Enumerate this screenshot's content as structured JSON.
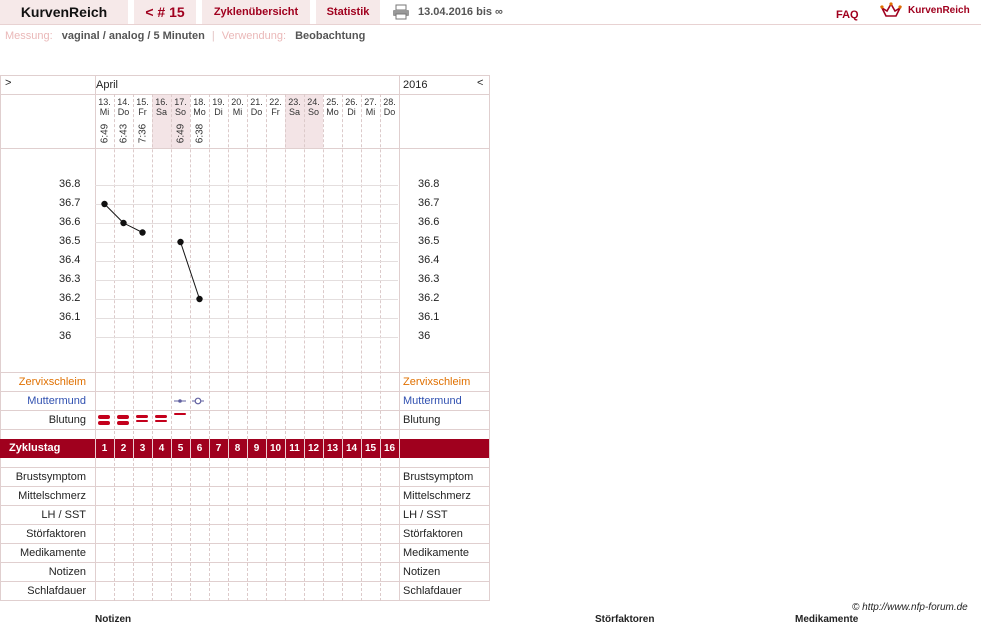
{
  "topbar": {
    "brand": "KurvenReich",
    "cycle": "< # 15",
    "overview": "Zyklenübersicht",
    "stats": "Statistik",
    "date_range": "13.04.2016 bis ∞",
    "faq": "FAQ",
    "logo_text": "KurvenReich"
  },
  "info": {
    "measure_label": "Messung:",
    "measure_value": "vaginal / analog / 5 Minuten",
    "use_label": "Verwendung:",
    "use_value": "Beobachtung"
  },
  "chart_header": {
    "nav_prev": ">",
    "nav_next": "<",
    "month": "April",
    "year": "2016"
  },
  "days": [
    {
      "date": "13.",
      "wd": "Mi",
      "time": "6:49",
      "weekend": false
    },
    {
      "date": "14.",
      "wd": "Do",
      "time": "6:43",
      "weekend": false
    },
    {
      "date": "15.",
      "wd": "Fr",
      "time": "7:36",
      "weekend": false
    },
    {
      "date": "16.",
      "wd": "Sa",
      "time": "",
      "weekend": true
    },
    {
      "date": "17.",
      "wd": "So",
      "time": "6:49",
      "weekend": true
    },
    {
      "date": "18.",
      "wd": "Mo",
      "time": "6:38",
      "weekend": false
    },
    {
      "date": "19.",
      "wd": "Di",
      "time": "",
      "weekend": false
    },
    {
      "date": "20.",
      "wd": "Mi",
      "time": "",
      "weekend": false
    },
    {
      "date": "21.",
      "wd": "Do",
      "time": "",
      "weekend": false
    },
    {
      "date": "22.",
      "wd": "Fr",
      "time": "",
      "weekend": false
    },
    {
      "date": "23.",
      "wd": "Sa",
      "time": "",
      "weekend": true
    },
    {
      "date": "24.",
      "wd": "So",
      "time": "",
      "weekend": true
    },
    {
      "date": "25.",
      "wd": "Mo",
      "time": "",
      "weekend": false
    },
    {
      "date": "26.",
      "wd": "Di",
      "time": "",
      "weekend": false
    },
    {
      "date": "27.",
      "wd": "Mi",
      "time": "",
      "weekend": false
    },
    {
      "date": "28.",
      "wd": "Do",
      "time": "",
      "weekend": false
    }
  ],
  "chart_data": {
    "type": "line",
    "ylim": [
      36.0,
      36.8
    ],
    "yticks": [
      "36.8",
      "36.7",
      "36.6",
      "36.5",
      "36.4",
      "36.3",
      "36.2",
      "36.1",
      "36"
    ],
    "segments": [
      [
        {
          "day": 1,
          "value": 36.7
        },
        {
          "day": 2,
          "value": 36.6
        },
        {
          "day": 3,
          "value": 36.55
        }
      ],
      [
        {
          "day": 5,
          "value": 36.5
        },
        {
          "day": 6,
          "value": 36.2
        }
      ]
    ]
  },
  "rows": {
    "cervix": "Zervixschleim",
    "mouth": "Muttermund",
    "bleeding": "Blutung",
    "cycle_day": "Zyklustag",
    "breast": "Brustsymptom",
    "midpain": "Mittelschmerz",
    "lh": "LH / SST",
    "disturb": "Störfaktoren",
    "meds": "Medikamente",
    "notes": "Notizen",
    "sleep": "Schlafdauer"
  },
  "cycle_days": [
    "1",
    "2",
    "3",
    "4",
    "5",
    "6",
    "7",
    "8",
    "9",
    "10",
    "11",
    "12",
    "13",
    "14",
    "15",
    "16"
  ],
  "bleeding": [
    3,
    3,
    2,
    2,
    1,
    0,
    0,
    0,
    0,
    0,
    0,
    0,
    0,
    0,
    0,
    0
  ],
  "footer": {
    "credit": "© http://www.nfp-forum.de",
    "bottom1": "Notizen",
    "bottom2": "Störfaktoren",
    "bottom3": "Medikamente"
  },
  "colors": {
    "accent": "#a0001e",
    "cervix": "#e07000",
    "mouth": "#3050b0"
  }
}
